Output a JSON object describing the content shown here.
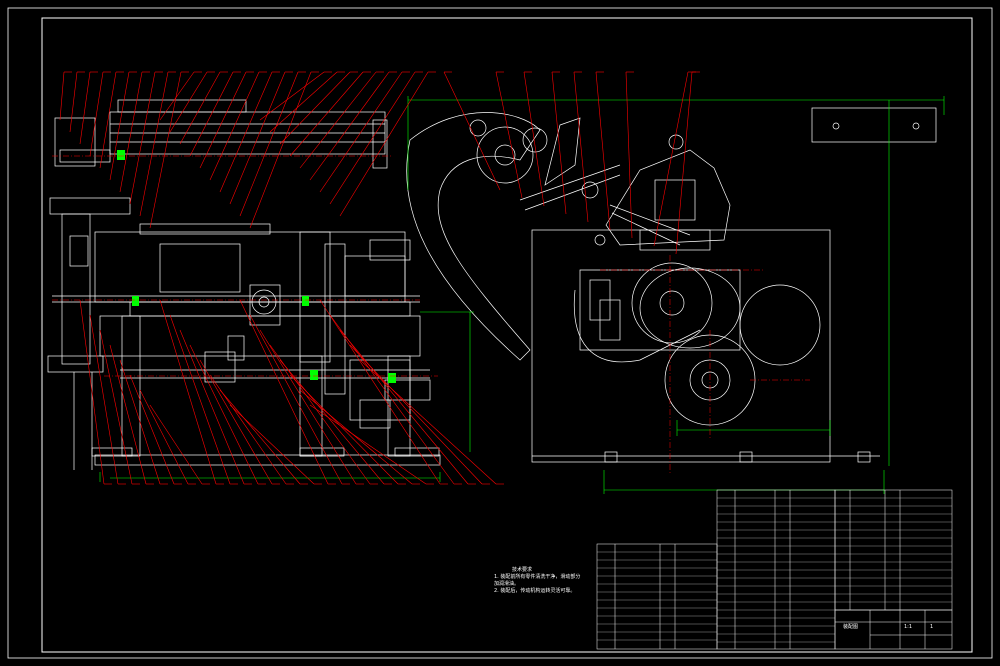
{
  "drawing": {
    "title_block": {
      "scale": "1:1",
      "sheet_label": "装配图",
      "quantity": "1"
    },
    "technical_requirements": {
      "heading": "技术要求",
      "lines": [
        "1. 装配前所有零件清洗干净，滑动部分",
        "   加润滑油。",
        "2. 装配后，传动机构运转灵活可靠。"
      ]
    },
    "colors": {
      "background": "#000000",
      "outline": "#ffffff",
      "balloon_leader": "#ff0000",
      "dimension": "#00ff00",
      "centerline": "#ff0000",
      "bearing_fill": "#00ff00"
    },
    "balloon_count_top_left": 29,
    "balloon_count_top_right": 9,
    "balloon_count_bottom": 29,
    "parts_rows": 20
  }
}
